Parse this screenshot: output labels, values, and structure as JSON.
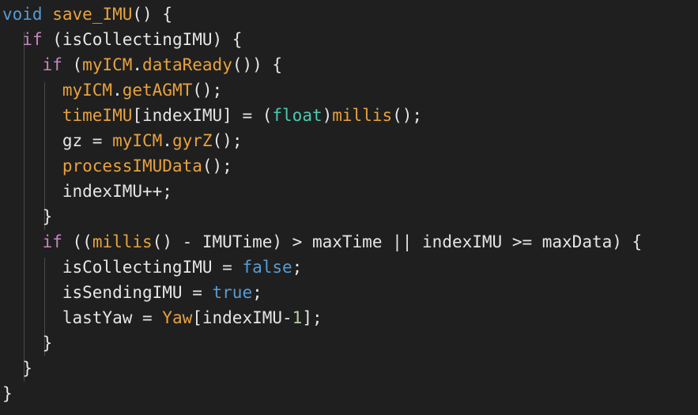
{
  "editor": {
    "colors": {
      "background": "#1f1f1f",
      "keyword": "#569cd6",
      "control": "#c586c0",
      "function": "#e8a23f",
      "plain": "#e6e6e6",
      "type": "#4ec9b0",
      "number": "#b5cea8"
    },
    "lines": [
      [
        {
          "t": "void",
          "c": "kw"
        },
        {
          "t": " ",
          "c": "plain"
        },
        {
          "t": "save_IMU",
          "c": "fn"
        },
        {
          "t": "() {",
          "c": "plain"
        }
      ],
      [
        {
          "t": "  ",
          "c": "plain"
        },
        {
          "t": "if",
          "c": "ctrl"
        },
        {
          "t": " (isCollectingIMU) {",
          "c": "plain"
        }
      ],
      [
        {
          "t": "    ",
          "c": "plain"
        },
        {
          "t": "if",
          "c": "ctrl"
        },
        {
          "t": " (",
          "c": "plain"
        },
        {
          "t": "myICM",
          "c": "fn"
        },
        {
          "t": ".",
          "c": "plain"
        },
        {
          "t": "dataReady",
          "c": "fn"
        },
        {
          "t": "()) {",
          "c": "plain"
        }
      ],
      [
        {
          "t": "      ",
          "c": "plain"
        },
        {
          "t": "myICM",
          "c": "fn"
        },
        {
          "t": ".",
          "c": "plain"
        },
        {
          "t": "getAGMT",
          "c": "fn"
        },
        {
          "t": "();",
          "c": "plain"
        }
      ],
      [
        {
          "t": "      ",
          "c": "plain"
        },
        {
          "t": "timeIMU",
          "c": "fn"
        },
        {
          "t": "[indexIMU] = (",
          "c": "plain"
        },
        {
          "t": "float",
          "c": "type"
        },
        {
          "t": ")",
          "c": "plain"
        },
        {
          "t": "millis",
          "c": "fn"
        },
        {
          "t": "();",
          "c": "plain"
        }
      ],
      [
        {
          "t": "      gz = ",
          "c": "plain"
        },
        {
          "t": "myICM",
          "c": "fn"
        },
        {
          "t": ".",
          "c": "plain"
        },
        {
          "t": "gyrZ",
          "c": "fn"
        },
        {
          "t": "();",
          "c": "plain"
        }
      ],
      [
        {
          "t": "      ",
          "c": "plain"
        },
        {
          "t": "processIMUData",
          "c": "fn"
        },
        {
          "t": "();",
          "c": "plain"
        }
      ],
      [
        {
          "t": "      indexIMU++;",
          "c": "plain"
        }
      ],
      [
        {
          "t": "    }",
          "c": "plain"
        }
      ],
      [
        {
          "t": "    ",
          "c": "plain"
        },
        {
          "t": "if",
          "c": "ctrl"
        },
        {
          "t": " ((",
          "c": "plain"
        },
        {
          "t": "millis",
          "c": "fn"
        },
        {
          "t": "() - IMUTime) > maxTime || indexIMU >= maxData) {",
          "c": "plain"
        }
      ],
      [
        {
          "t": "      isCollectingIMU = ",
          "c": "plain"
        },
        {
          "t": "false",
          "c": "kw"
        },
        {
          "t": ";",
          "c": "plain"
        }
      ],
      [
        {
          "t": "      isSendingIMU = ",
          "c": "plain"
        },
        {
          "t": "true",
          "c": "kw"
        },
        {
          "t": ";",
          "c": "plain"
        }
      ],
      [
        {
          "t": "      lastYaw = ",
          "c": "plain"
        },
        {
          "t": "Yaw",
          "c": "fn"
        },
        {
          "t": "[indexIMU-",
          "c": "plain"
        },
        {
          "t": "1",
          "c": "num"
        },
        {
          "t": "];",
          "c": "plain"
        }
      ],
      [
        {
          "t": "    }",
          "c": "plain"
        }
      ],
      [
        {
          "t": "  }",
          "c": "plain"
        }
      ],
      [
        {
          "t": "}",
          "c": "plain"
        }
      ]
    ]
  }
}
